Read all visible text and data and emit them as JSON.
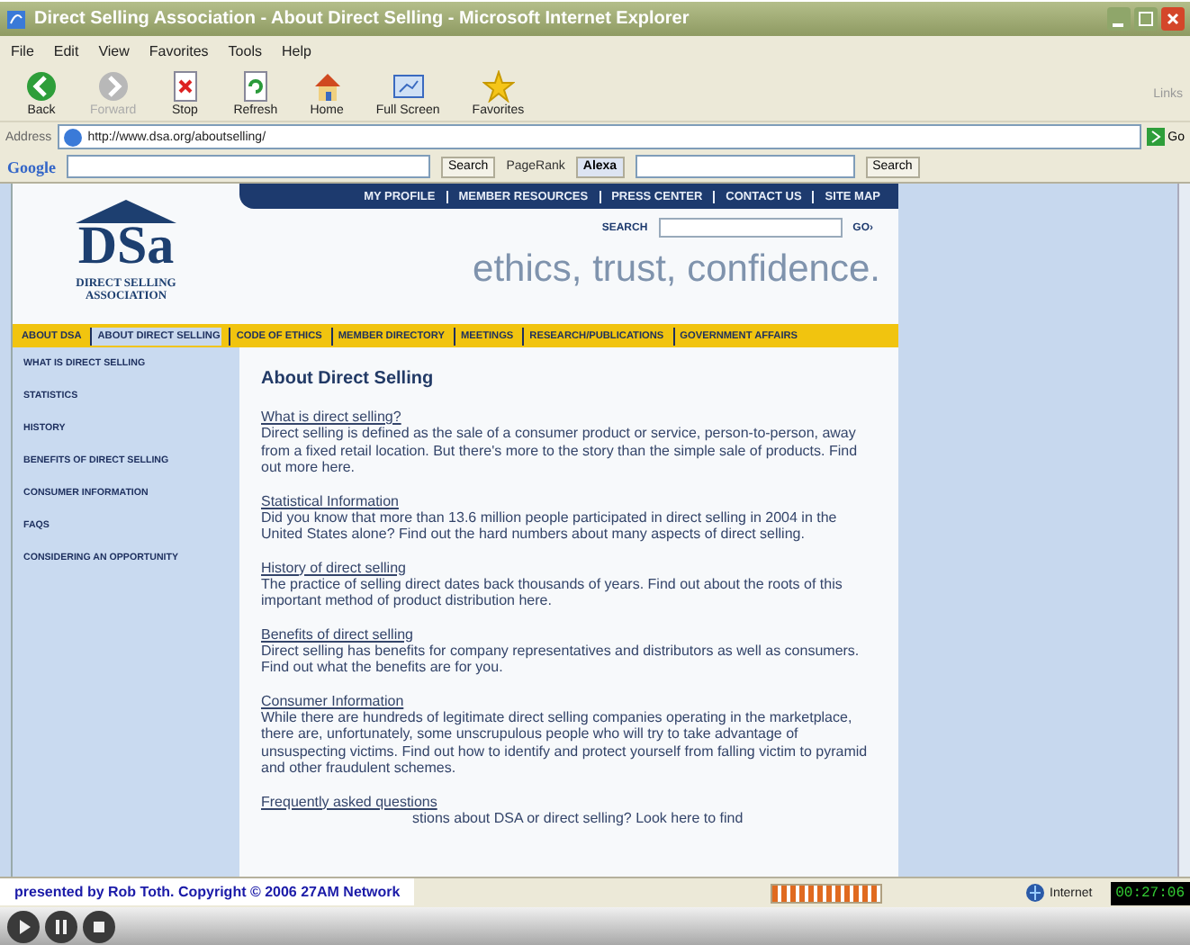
{
  "window": {
    "title": "Direct Selling Association - About Direct Selling - Microsoft Internet Explorer"
  },
  "menu": [
    "File",
    "Edit",
    "View",
    "Favorites",
    "Tools",
    "Help"
  ],
  "toolbar": [
    {
      "label": "Back",
      "kind": "back",
      "disabled": false
    },
    {
      "label": "Forward",
      "kind": "forward",
      "disabled": true
    },
    {
      "label": "Stop",
      "kind": "stop",
      "disabled": false
    },
    {
      "label": "Refresh",
      "kind": "refresh",
      "disabled": false
    },
    {
      "label": "Home",
      "kind": "home",
      "disabled": false
    },
    {
      "label": "Full Screen",
      "kind": "fullscreen",
      "disabled": false
    },
    {
      "label": "Favorites",
      "kind": "favorites",
      "disabled": false
    }
  ],
  "links": "Links",
  "address": {
    "label": "Address",
    "url": "http://www.dsa.org/aboutselling/",
    "go": "Go"
  },
  "google_bar": {
    "logo": "Google",
    "search": "Search",
    "pagerank": "PageRank",
    "alexa": "Alexa",
    "search_2": "Search"
  },
  "site": {
    "top_nav": [
      "MY PROFILE",
      "MEMBER RESOURCES",
      "PRESS CENTER",
      "CONTACT US",
      "SITE MAP"
    ],
    "search_label": "SEARCH",
    "go": "GO›",
    "logo": {
      "mark": "DSa",
      "name": "DIRECT SELLING ASSOCIATION"
    },
    "tagline": "ethics, trust, confidence.",
    "main_nav": [
      {
        "label": "ABOUT DSA",
        "selected": false
      },
      {
        "label": "ABOUT DIRECT SELLING",
        "selected": true
      },
      {
        "label": "CODE OF ETHICS",
        "selected": false
      },
      {
        "label": "MEMBER DIRECTORY",
        "selected": false
      },
      {
        "label": "MEETINGS",
        "selected": false
      },
      {
        "label": "RESEARCH/PUBLICATIONS",
        "selected": false
      },
      {
        "label": "GOVERNMENT AFFAIRS",
        "selected": false
      }
    ],
    "side_nav": [
      "WHAT IS DIRECT SELLING",
      "STATISTICS",
      "HISTORY",
      "BENEFITS OF DIRECT SELLING",
      "CONSUMER INFORMATION",
      "FAQS",
      "CONSIDERING AN OPPORTUNITY"
    ],
    "heading": "About Direct Selling",
    "sections": [
      {
        "title": "What is direct selling?",
        "text": "Direct selling is defined as the sale of a consumer product or service, person-to-person, away from a fixed retail location. But there's more to the story than the simple sale of products. Find out more here."
      },
      {
        "title": "Statistical Information",
        "text": "Did you know that more than 13.6 million people participated in direct selling in 2004 in the United States alone? Find out the hard numbers about many aspects of direct selling."
      },
      {
        "title": "History of direct selling",
        "text": "The practice of selling direct dates back thousands of years. Find out about the roots of this important method of product distribution here."
      },
      {
        "title": "Benefits of direct selling",
        "text": "Direct selling has benefits for company representatives and distributors as well as consumers. Find out what the benefits are for you."
      },
      {
        "title": "Consumer Information",
        "text": "While there are hundreds of legitimate direct selling companies operating in the marketplace, there are, unfortunately, some unscrupulous people who will try to take advantage of unsuspecting victims. Find out how to identify and protect yourself from falling victim to pyramid and other fraudulent schemes."
      },
      {
        "title": "Frequently asked questions",
        "text": "stions about DSA or direct selling? Look here to find"
      }
    ]
  },
  "caption": "presented by Rob Toth. Copyright © 2006 27AM Network",
  "status": {
    "level": 1,
    "zone": "Internet"
  },
  "player": {
    "time": "00:27:06",
    "controls": [
      {
        "kind": "play"
      },
      {
        "kind": "pause"
      },
      {
        "kind": "stop"
      }
    ]
  }
}
